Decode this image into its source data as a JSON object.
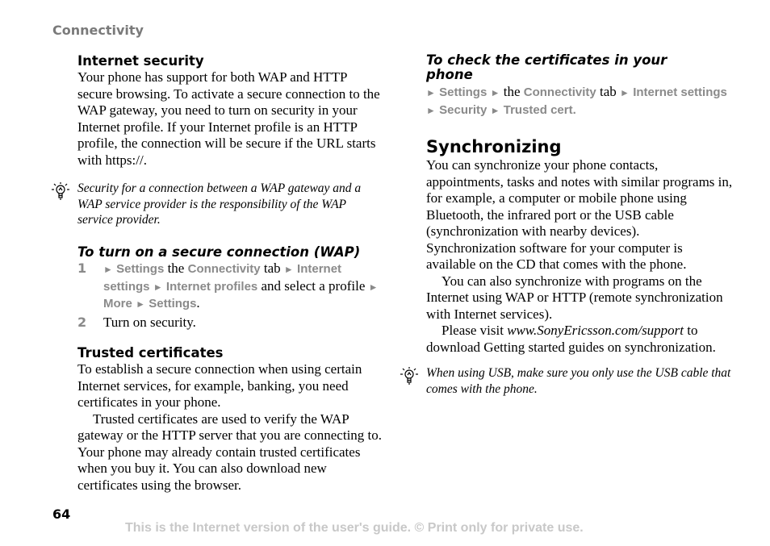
{
  "header": {
    "section": "Connectivity"
  },
  "left": {
    "internet_security": {
      "heading": "Internet security",
      "body": "Your phone has support for both WAP and HTTP secure browsing. To activate a secure connection to the WAP gateway, you need to turn on security in your Internet profile. If your Internet profile is an HTTP profile, the connection will be secure if the URL starts with https://."
    },
    "tip1": "Security for a connection between a WAP gateway and a WAP service provider is the responsibility of the WAP service provider.",
    "secure_wap": {
      "heading": "To turn on a secure connection (WAP)",
      "step1": {
        "num": "1",
        "settings": "Settings",
        "the": " the ",
        "connectivity": "Connectivity",
        "tab": " tab ",
        "internet_settings": "Internet settings",
        "internet_profiles": "Internet profiles",
        "select": " and select a profile ",
        "more": "More",
        "settings2": "Settings",
        "period": "."
      },
      "step2": {
        "num": "2",
        "text": "Turn on security."
      }
    },
    "trusted": {
      "heading": "Trusted certificates",
      "p1": "To establish a secure connection when using certain Internet services, for example, banking, you need certificates in your phone.",
      "p2": "Trusted certificates are used to verify the WAP gateway or the HTTP server that you are connecting to. Your phone may already contain trusted certificates when you buy it. You can also download new certificates using the browser."
    }
  },
  "right": {
    "check_certs": {
      "heading": "To check the certificates in your phone",
      "settings": "Settings",
      "the": " the ",
      "connectivity": "Connectivity",
      "tab": " tab ",
      "internet_settings": "Internet settings",
      "security": "Security",
      "trusted_cert": "Trusted cert."
    },
    "sync": {
      "heading": "Synchronizing",
      "p1": "You can synchronize your phone contacts, appointments, tasks and notes with similar programs in, for example, a computer or mobile phone using Bluetooth, the infrared port or the USB cable (synchronization with nearby devices). Synchronization software for your computer is available on the CD that comes with the phone.",
      "p2": "You can also synchronize with programs on the Internet using WAP or HTTP (remote synchronization with Internet services).",
      "p3_pre": "Please visit ",
      "p3_link": "www.SonyEricsson.com/support",
      "p3_post": " to download Getting started guides on synchronization."
    },
    "tip2": "When using USB, make sure you only use the USB cable that comes with the phone."
  },
  "page_number": "64",
  "footer": "This is the Internet version of the user's guide. © Print only for private use."
}
